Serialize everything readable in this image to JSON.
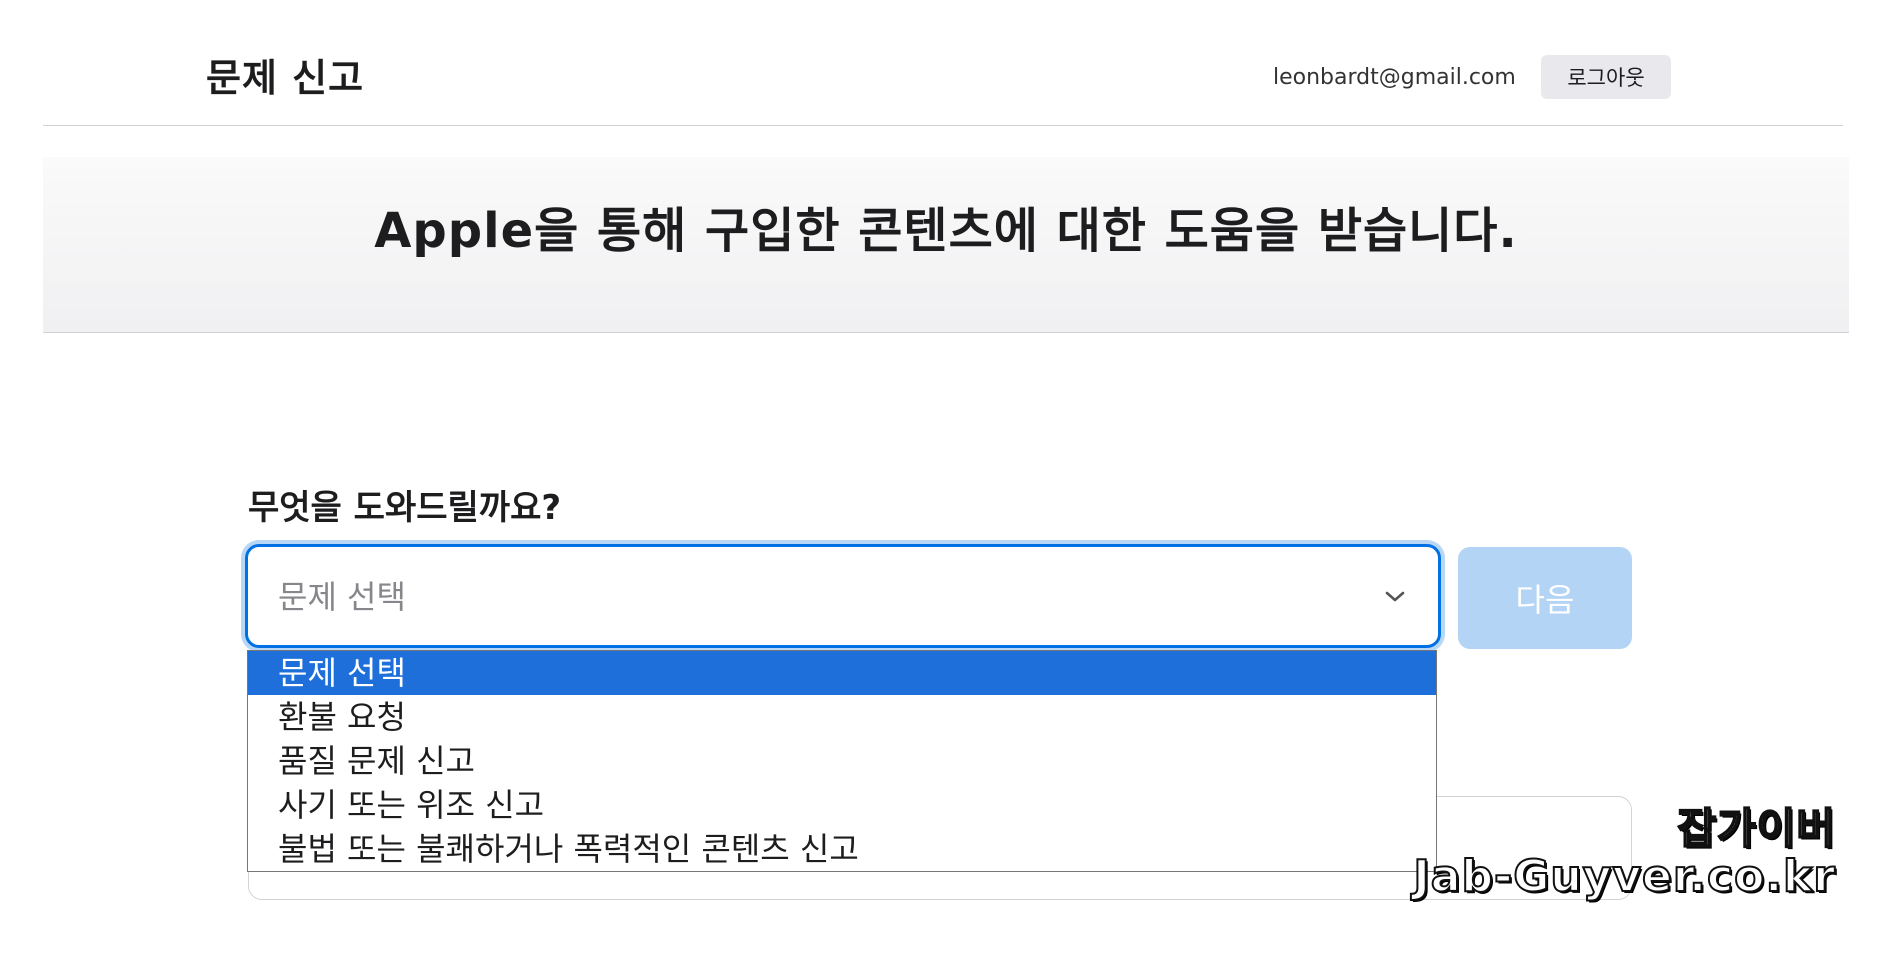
{
  "header": {
    "title": "문제 신고",
    "account_email": "leonbardt@gmail.com",
    "logout_label": "로그아웃"
  },
  "hero": {
    "title": "Apple을 통해 구입한 콘텐츠에 대한 도움을 받습니다."
  },
  "form": {
    "question_label": "무엇을 도와드릴까요?",
    "select_value": "문제 선택",
    "next_label": "다음",
    "options": [
      "문제 선택",
      "환불 요청",
      "품질 문제 신고",
      "사기 또는 위조 신고",
      "불법 또는 불쾌하거나 폭력적인 콘텐츠 신고"
    ],
    "selected_index": 0
  },
  "watermark": {
    "line1": "잡가이버",
    "line2": "Jab-Guyver.co.kr"
  },
  "colors": {
    "accent": "#0071e3",
    "selected_option_bg": "#1e6fd9",
    "next_disabled_bg": "#b3d4f5"
  }
}
